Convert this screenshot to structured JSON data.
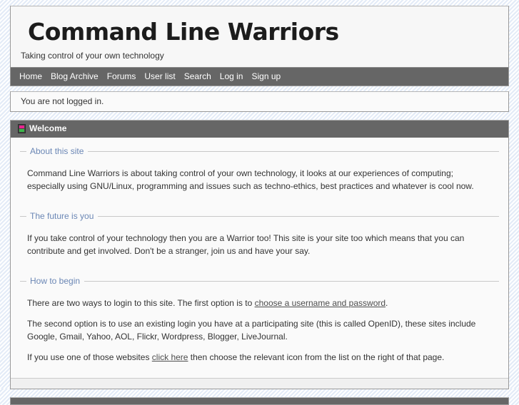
{
  "site": {
    "logo_text": "Command Line Warriors",
    "tagline": "Taking control of your own technology"
  },
  "nav": {
    "items": [
      {
        "label": "Home"
      },
      {
        "label": "Blog Archive"
      },
      {
        "label": "Forums"
      },
      {
        "label": "User list"
      },
      {
        "label": "Search"
      },
      {
        "label": "Log in"
      },
      {
        "label": "Sign up"
      }
    ]
  },
  "status": {
    "text": "You are not logged in."
  },
  "panel": {
    "title": "Welcome",
    "toggle_icon": "collapse-toggle-icon"
  },
  "sections": [
    {
      "legend": "About this site",
      "paragraphs": [
        "Command Line Warriors is about taking control of your own technology, it looks at our experiences of computing; especially using GNU/Linux, programming and issues such as techno-ethics, best practices and whatever is cool now."
      ]
    },
    {
      "legend": "The future is you",
      "paragraphs": [
        "If you take control of your technology then you are a Warrior too! This site is your site too which means that you can contribute and get involved. Don't be a stranger, join us and have your say."
      ]
    },
    {
      "legend": "How to begin",
      "paragraphs": []
    }
  ],
  "how_to_begin": {
    "p1_before": "There are two ways to login to this site. The first option is to ",
    "p1_link": "choose a username and password",
    "p1_after": ".",
    "p2": "The second option is to use an existing login you have at a participating site (this is called OpenID), these sites include Google, Gmail, Yahoo, AOL, Flickr, Wordpress, Blogger, LiveJournal.",
    "p3_before": "If you use one of those websites ",
    "p3_link": "click here",
    "p3_after": " then choose the relevant icon from the list on the right of that page."
  },
  "colors": {
    "nav_bar": "#666666",
    "panel_header": "#666666",
    "legend_text": "#6b87b5",
    "body_text": "#333333",
    "page_background": "#e3ebf7",
    "panel_background": "#fafafa",
    "icon_top": "#e8238f",
    "icon_bottom": "#3bb64a"
  }
}
